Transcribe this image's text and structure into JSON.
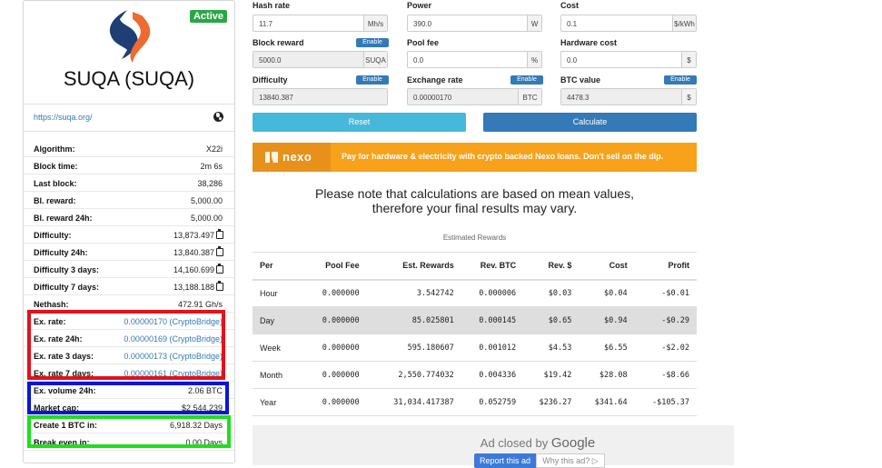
{
  "coin": {
    "name": "SUQA (SUQA)",
    "status": "Active",
    "url": "https://suqa.org/"
  },
  "stats": [
    {
      "label": "Algorithm:",
      "value": "X22i"
    },
    {
      "label": "Block time:",
      "value": "2m 6s"
    },
    {
      "label": "Last block:",
      "value": "38,286"
    },
    {
      "label": "Bl. reward:",
      "value": "5,000.00"
    },
    {
      "label": "Bl. reward 24h:",
      "value": "5,000.00"
    },
    {
      "label": "Difficulty:",
      "value": "13,873.497"
    },
    {
      "label": "Difficulty 24h:",
      "value": "13,840.387"
    },
    {
      "label": "Difficulty 3 days:",
      "value": "14,160.699"
    },
    {
      "label": "Difficulty 7 days:",
      "value": "13,188.188"
    },
    {
      "label": "Nethash:",
      "value": "472.91 Gh/s"
    },
    {
      "label": "Ex. rate:",
      "value": "0.00000170 (CryptoBridge)"
    },
    {
      "label": "Ex. rate 24h:",
      "value": "0.00000169 (CryptoBridge)"
    },
    {
      "label": "Ex. rate 3 days:",
      "value": "0.00000173 (CryptoBridge)"
    },
    {
      "label": "Ex. rate 7 days:",
      "value": "0.00000161 (CryptoBridge)"
    },
    {
      "label": "Ex. volume 24h:",
      "value": "2.06 BTC"
    },
    {
      "label": "Market cap:",
      "value": "$2,544,239"
    },
    {
      "label": "Create 1 BTC in:",
      "value": "6,918.32 Days"
    },
    {
      "label": "Break even in:",
      "value": "0.00 Days"
    }
  ],
  "form": {
    "enable_label": "Enable",
    "hashrate": {
      "label": "Hash rate",
      "value": "11.7",
      "unit": "Mh/s"
    },
    "power": {
      "label": "Power",
      "value": "390.0",
      "unit": "W"
    },
    "cost": {
      "label": "Cost",
      "value": "0.1",
      "unit": "$/kWh"
    },
    "block_reward": {
      "label": "Block reward",
      "value": "5000.0",
      "unit": "SUQA"
    },
    "pool_fee": {
      "label": "Pool fee",
      "value": "0.0",
      "unit": "%"
    },
    "hardware_cost": {
      "label": "Hardware cost",
      "value": "0.0",
      "unit": "$"
    },
    "difficulty": {
      "label": "Difficulty",
      "value": "13840.387"
    },
    "exchange_rate": {
      "label": "Exchange rate",
      "value": "0.00000170",
      "unit": "BTC"
    },
    "btc_value": {
      "label": "BTC value",
      "value": "4478.3",
      "unit": "$"
    },
    "reset_label": "Reset",
    "calculate_label": "Calculate"
  },
  "banner": {
    "brand": "nexo",
    "text": "Pay for hardware & electricity with crypto backed Nexo loans. Don't sell on the dip."
  },
  "note": {
    "line1": "Please note that calculations are based on mean values,",
    "line2": "therefore your final results may vary."
  },
  "rewards": {
    "caption": "Estimated Rewards",
    "headers": [
      "Per",
      "Pool Fee",
      "Est. Rewards",
      "Rev. BTC",
      "Rev. $",
      "Cost",
      "Profit"
    ],
    "rows": [
      [
        "Hour",
        "0.000000",
        "3.542742",
        "0.000006",
        "$0.03",
        "$0.04",
        "-$0.01"
      ],
      [
        "Day",
        "0.000000",
        "85.025801",
        "0.000145",
        "$0.65",
        "$0.94",
        "-$0.29"
      ],
      [
        "Week",
        "0.000000",
        "595.180607",
        "0.001012",
        "$4.53",
        "$6.55",
        "-$2.02"
      ],
      [
        "Month",
        "0.000000",
        "2,550.774032",
        "0.004336",
        "$19.42",
        "$28.08",
        "-$8.66"
      ],
      [
        "Year",
        "0.000000",
        "31,034.417387",
        "0.052759",
        "$236.27",
        "$341.64",
        "-$105.37"
      ]
    ]
  },
  "ad": {
    "closed_text": "Ad closed by",
    "brand": "Google",
    "report_label": "Report this ad",
    "why_label": "Why this ad? ▷"
  },
  "colors": {
    "primary": "#337ab7",
    "info": "#46b8da",
    "success": "#28a745",
    "nexo": "#f7a21a",
    "annotation_red": "#e3121b",
    "annotation_blue": "#0a14d9",
    "annotation_green": "#1ce01b"
  }
}
